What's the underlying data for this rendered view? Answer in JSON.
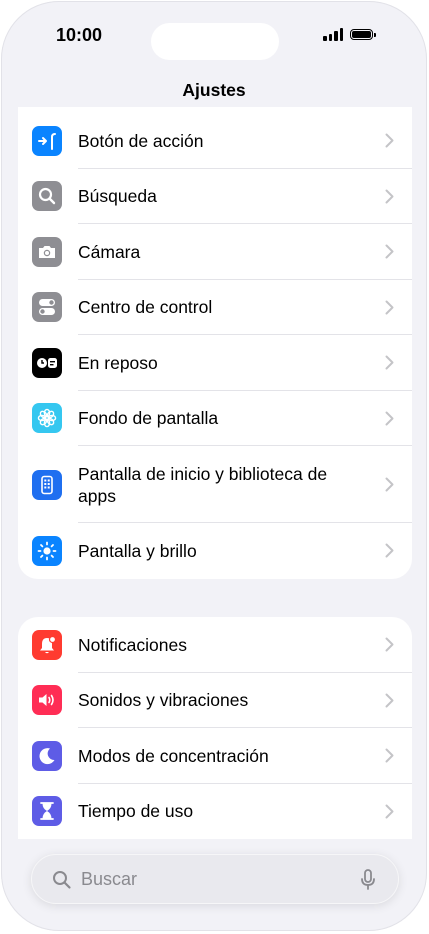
{
  "status_bar": {
    "time": "10:00",
    "signal_icon": "cellular-signal-icon",
    "battery_icon": "battery-full-icon"
  },
  "nav": {
    "title": "Ajustes"
  },
  "group1": {
    "items": [
      {
        "label": "Botón de acción",
        "icon": "action-button-icon",
        "color": "#0a84ff"
      },
      {
        "label": "Búsqueda",
        "icon": "magnifier-icon",
        "color": "#8e8e93"
      },
      {
        "label": "Cámara",
        "icon": "camera-icon",
        "color": "#8e8e93"
      },
      {
        "label": "Centro de control",
        "icon": "toggles-icon",
        "color": "#8e8e93"
      },
      {
        "label": "En reposo",
        "icon": "standby-icon",
        "color": "#000000"
      },
      {
        "label": "Fondo de pantalla",
        "icon": "flower-icon",
        "color": "#35c7f0"
      },
      {
        "label": "Pantalla de inicio y biblioteca de apps",
        "icon": "home-screen-icon",
        "color": "#1f6ff0"
      },
      {
        "label": "Pantalla y brillo",
        "icon": "sun-icon",
        "color": "#0a84ff"
      }
    ]
  },
  "group2": {
    "items": [
      {
        "label": "Notificaciones",
        "icon": "bell-icon",
        "color": "#ff3b30"
      },
      {
        "label": "Sonidos y vibraciones",
        "icon": "speaker-icon",
        "color": "#ff2d55"
      },
      {
        "label": "Modos de concentración",
        "icon": "moon-icon",
        "color": "#5e5ce6"
      },
      {
        "label": "Tiempo de uso",
        "icon": "hourglass-icon",
        "color": "#5e5ce6"
      }
    ]
  },
  "search": {
    "placeholder": "Buscar",
    "mic_icon": "microphone-icon"
  }
}
